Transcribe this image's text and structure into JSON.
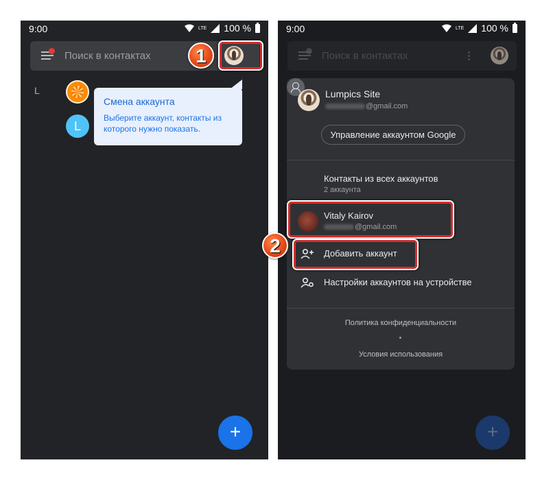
{
  "left_screen": {
    "status": {
      "time": "9:00",
      "network": "LTE",
      "battery": "100 %"
    },
    "search": {
      "placeholder": "Поиск в контактах"
    },
    "step_badge": "1",
    "contacts": {
      "section_letter": "L",
      "second_avatar_letter": "L"
    },
    "tooltip": {
      "title": "Смена аккаунта",
      "text": "Выберите аккаунт, контакты из которого нужно показать."
    },
    "fab_label": "+"
  },
  "right_screen": {
    "status": {
      "time": "9:00",
      "network": "LTE",
      "battery": "100 %"
    },
    "search": {
      "placeholder": "Поиск в контактах"
    },
    "account": {
      "name": "Lumpics Site",
      "email_suffix": "@gmail.com",
      "manage_label": "Управление аккаунтом Google"
    },
    "all_contacts": {
      "title": "Контакты из всех аккаунтов",
      "subtitle": "2 аккаунта"
    },
    "other_account": {
      "name": "Vitaly Kairov",
      "email_suffix": "@gmail.com"
    },
    "add_account_label": "Добавить аккаунт",
    "device_settings_label": "Настройки аккаунтов на устройстве",
    "privacy_label": "Политика конфиденциальности",
    "separator": "•",
    "terms_label": "Условия использования",
    "step_badge": "2",
    "fab_label": "+"
  },
  "colors": {
    "highlight": "#d32f2f",
    "fab": "#1a73e8",
    "tooltip_bg": "#e8f0fe",
    "badge": "#e64a19"
  }
}
